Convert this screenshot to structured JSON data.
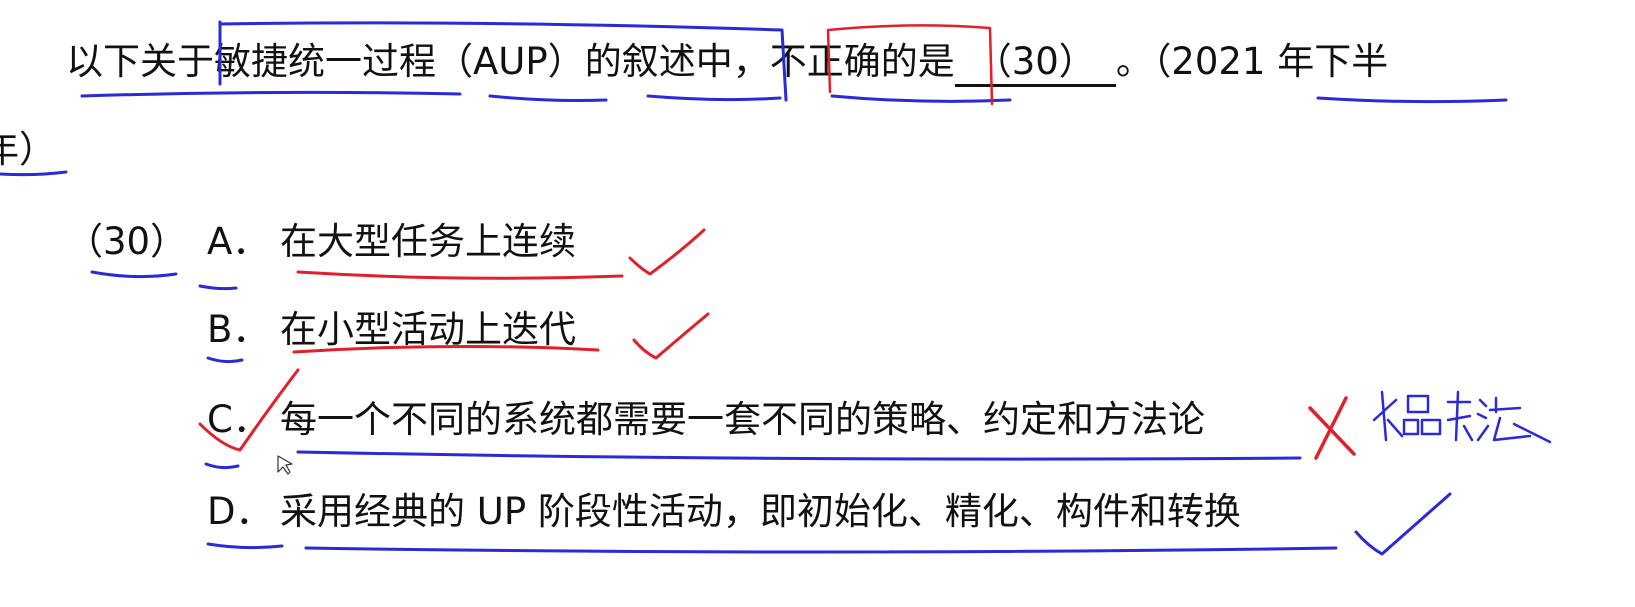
{
  "question": {
    "before_bracket": "以下关于敏捷统一过程（AUP）的叙述中，不正确的是",
    "blank": "（30）",
    "after_blank": "。",
    "year_open": "（2021 年下半",
    "year_close": "年）"
  },
  "options": {
    "number": "（30）",
    "a": {
      "letter": "A．",
      "text": "在大型任务上连续"
    },
    "b": {
      "letter": "B．",
      "text": "在小型活动上迭代"
    },
    "c": {
      "letter": "C．",
      "text": "每一个不同的系统都需要一套不同的策略、约定和方法论"
    },
    "d": {
      "letter": "D．",
      "text": "采用经典的 UP 阶段性活动，即初始化、精化、构件和转换"
    }
  },
  "annotations": {
    "handwritten_note": "水晶方法",
    "colors": {
      "red": "#e0202a",
      "blue": "#2a2ad8"
    }
  }
}
